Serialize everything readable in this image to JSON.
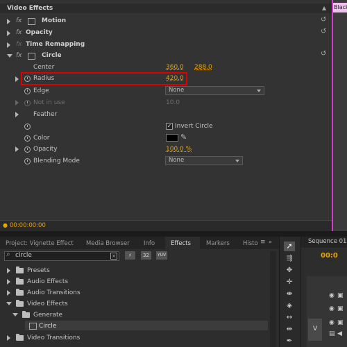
{
  "effect_controls": {
    "header_title": "Video Effects",
    "sequence_clip_label": "Black",
    "rows": {
      "motion": "Motion",
      "opacity": "Opacity",
      "time_remapping": "Time Remapping",
      "circle": "Circle",
      "center": "Center",
      "center_x": "360.0",
      "center_y": "288.0",
      "radius": "Radius",
      "radius_value": "420.0",
      "edge": "Edge",
      "edge_value": "None",
      "not_in_use": "Not in use",
      "not_in_use_value": "10.0",
      "feather": "Feather",
      "invert_circle": "Invert Circle",
      "color": "Color",
      "opacity_prop": "Opacity",
      "opacity_value": "100.0 %",
      "blending_mode": "Blending Mode",
      "blending_value": "None"
    },
    "timecode": "00:00:00:00",
    "colors": {
      "value_orange": "#e8a400",
      "highlight_red": "#e00000",
      "playhead_pink": "#d23cc8"
    }
  },
  "project_panel": {
    "tabs": [
      "Project: Vignette Effect",
      "Media Browser",
      "Info",
      "Effects",
      "Markers",
      "Histo"
    ],
    "active_tab": "Effects",
    "search_value": "circle",
    "filter_buttons": [
      "32",
      "YUV"
    ],
    "tree": {
      "presets": "Presets",
      "audio_effects": "Audio Effects",
      "audio_transitions": "Audio Transitions",
      "video_effects": "Video Effects",
      "generate": "Generate",
      "circle": "Circle",
      "video_transitions": "Video Transitions"
    }
  },
  "sequence_panel": {
    "tab": "Sequence 01",
    "timecode": "00:0",
    "track_label": "V"
  },
  "icons": [
    "fx-icon",
    "stopwatch-icon",
    "reset-icon",
    "eyedropper-icon",
    "folder-icon",
    "search-icon",
    "clear-icon",
    "selection-tool-icon",
    "eye-icon",
    "film-icon"
  ]
}
